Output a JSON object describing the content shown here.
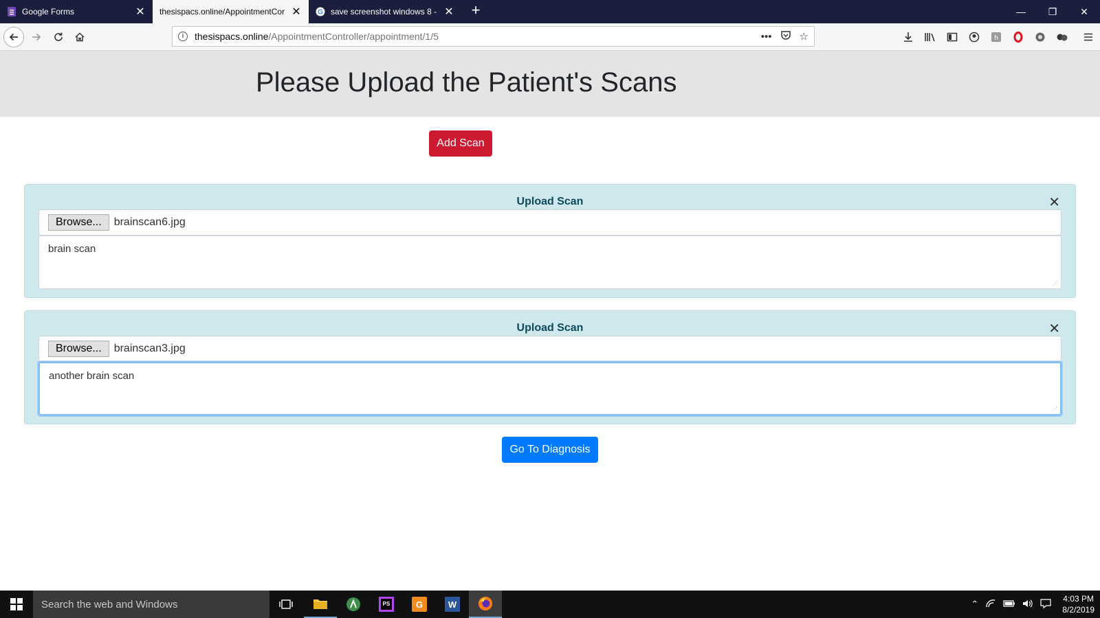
{
  "browser": {
    "tabs": [
      {
        "title": "Google Forms",
        "icon": "google-forms-icon",
        "active": false
      },
      {
        "title": "thesispacs.online/AppointmentCor",
        "icon": "",
        "active": true
      },
      {
        "title": "save screenshot windows 8 - Go",
        "icon": "google-icon",
        "active": false
      }
    ],
    "url_host": "thesispacs.online",
    "url_path": "/AppointmentController/appointment/1/5"
  },
  "page": {
    "title": "Please Upload the Patient's Scans",
    "add_scan_label": "Add Scan",
    "scans": [
      {
        "heading": "Upload Scan",
        "browse_label": "Browse...",
        "file_name": "brainscan6.jpg",
        "description": "brain scan"
      },
      {
        "heading": "Upload Scan",
        "browse_label": "Browse...",
        "file_name": "brainscan3.jpg",
        "description": "another brain scan"
      }
    ],
    "go_to_diagnosis_label": "Go To Diagnosis"
  },
  "taskbar": {
    "search_placeholder": "Search the web and Windows",
    "time": "4:03 PM",
    "date": "8/2/2019"
  },
  "colors": {
    "add_button": "#cc1a30",
    "primary_button": "#007bff",
    "card_bg": "#cfe8ed",
    "card_title": "#0c4a5a",
    "tabstrip": "#1b1e3d"
  }
}
